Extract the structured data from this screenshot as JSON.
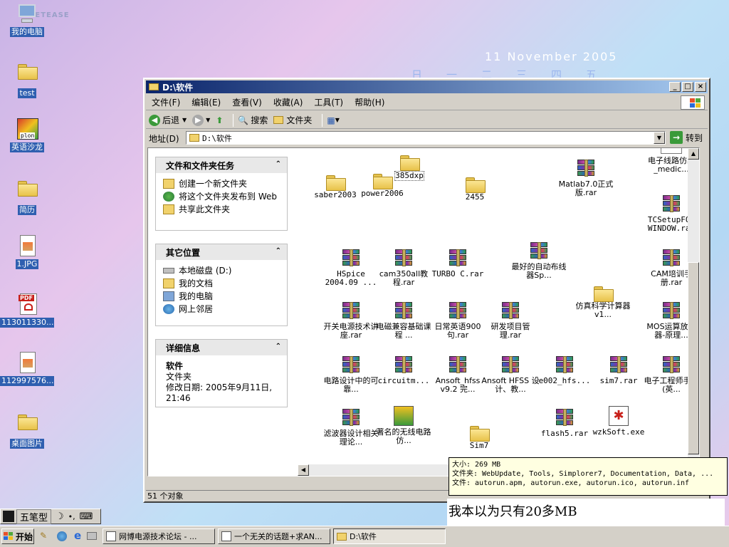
{
  "desktop": {
    "netease_logo": "NETEASE",
    "calendar": {
      "date": "11 November 2005",
      "weekdays": [
        "日",
        "一",
        "二",
        "三",
        "四",
        "五"
      ]
    },
    "icons": [
      {
        "label": "我的电脑",
        "icon": "computer-icon"
      },
      {
        "label": "test",
        "icon": "folder-icon"
      },
      {
        "label": "英语沙龙",
        "icon": "shortcut-icon",
        "badge": "plon"
      },
      {
        "label": "简历",
        "icon": "folder-icon"
      },
      {
        "label": "1.JPG",
        "icon": "image-file-icon"
      },
      {
        "label": "113011330...",
        "icon": "pdf-file-icon",
        "badge": "PDF"
      },
      {
        "label": "112997576...",
        "icon": "image-file-icon"
      },
      {
        "label": "桌面图片",
        "icon": "folder-icon"
      }
    ]
  },
  "window": {
    "title": "D:\\软件",
    "buttons": {
      "minimize": "_",
      "maximize": "□",
      "close": "×"
    },
    "menu": [
      "文件(F)",
      "编辑(E)",
      "查看(V)",
      "收藏(A)",
      "工具(T)",
      "帮助(H)"
    ],
    "toolbar": {
      "back": "后退",
      "search": "搜索",
      "folders": "文件夹"
    },
    "address": {
      "label": "地址(D)",
      "value": "D:\\软件",
      "go": "转到"
    },
    "left_pane": {
      "tasks": {
        "title": "文件和文件夹任务",
        "items": [
          "创建一个新文件夹",
          "将这个文件夹发布到 Web",
          "共享此文件夹"
        ]
      },
      "places": {
        "title": "其它位置",
        "items": [
          "本地磁盘 (D:)",
          "我的文档",
          "我的电脑",
          "网上邻居"
        ]
      },
      "details": {
        "title": "详细信息",
        "name": "软件",
        "type": "文件夹",
        "modified": "修改日期: 2005年9月11日, 21:46"
      }
    },
    "files": [
      {
        "name": "385dxp",
        "type": "folder"
      },
      {
        "name": "电子线路仿真_medic...",
        "type": "folder"
      },
      {
        "name": "saber2003",
        "type": "folder"
      },
      {
        "name": "power2006",
        "type": "folder"
      },
      {
        "name": "2455",
        "type": "folder"
      },
      {
        "name": "Matlab7.0正式版.rar",
        "type": "rar"
      },
      {
        "name": "TCSetupFOR WINDOW.rar",
        "type": "rar"
      },
      {
        "name": "HSpice 2004.09 ...",
        "type": "rar"
      },
      {
        "name": "cam350all教程.rar",
        "type": "rar"
      },
      {
        "name": "TURBO C.rar",
        "type": "rar"
      },
      {
        "name": "最好的自动布线器Sp...",
        "type": "rar"
      },
      {
        "name": "CAM培训手册.rar",
        "type": "rar"
      },
      {
        "name": "仿真科学计算器 v1...",
        "type": "folder"
      },
      {
        "name": "开关电源技术讲座.rar",
        "type": "rar"
      },
      {
        "name": "电磁兼容基础课程 ...",
        "type": "rar"
      },
      {
        "name": "日常英语900句.rar",
        "type": "rar"
      },
      {
        "name": "研发项目管理.rar",
        "type": "rar"
      },
      {
        "name": "MOS运算放大器-原理...",
        "type": "rar"
      },
      {
        "name": "电路设计中的可靠...",
        "type": "rar"
      },
      {
        "name": "circuitm...",
        "type": "rar"
      },
      {
        "name": "Ansoft_hfss v9.2 完...",
        "type": "rar"
      },
      {
        "name": "Ansoft HFSS 设计、教...",
        "type": "rar"
      },
      {
        "name": "e002_hfs...",
        "type": "rar"
      },
      {
        "name": "sim7.rar",
        "type": "rar"
      },
      {
        "name": "电子工程师手册(英...",
        "type": "rar"
      },
      {
        "name": "滤波器设计相关理论...",
        "type": "rar"
      },
      {
        "name": "著名的无线电路仿...",
        "type": "installer"
      },
      {
        "name": "Sim7",
        "type": "folder"
      },
      {
        "name": "flash5.rar",
        "type": "rar"
      },
      {
        "name": "wzkSoft.exe",
        "type": "exe"
      }
    ],
    "status": "51 个对象"
  },
  "tooltip": {
    "lines": [
      "大小: 269 MB",
      "文件夹: WebUpdate, Tools, Simplorer7, Documentation, Data, ...",
      "文件: autorun.apm, autorun.exe, autorun.ico, autorun.inf"
    ]
  },
  "caption": "我本以为只有20多MB",
  "ime": {
    "mode": "五笔型"
  },
  "taskbar": {
    "start": "开始",
    "tasks": [
      "网博电源技术论坛 - ...",
      "一个无关的话题+求AN...",
      "D:\\软件"
    ]
  }
}
